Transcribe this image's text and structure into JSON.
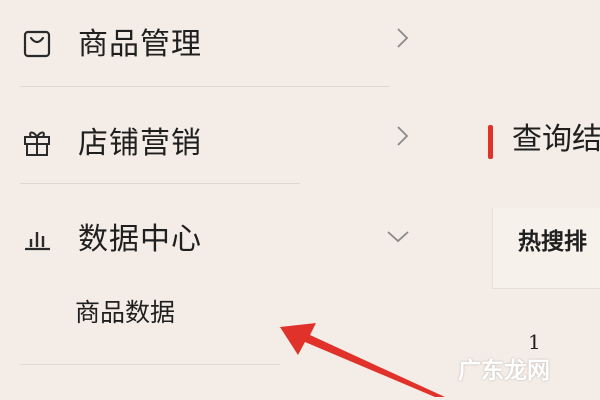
{
  "sidebar": {
    "items": [
      {
        "label": "商品管理",
        "icon": "shopping-bag-icon",
        "state": "collapsed"
      },
      {
        "label": "店铺营销",
        "icon": "gift-icon",
        "state": "collapsed"
      },
      {
        "label": "数据中心",
        "icon": "bar-chart-icon",
        "state": "expanded"
      }
    ],
    "subitems": [
      {
        "label": "商品数据"
      }
    ]
  },
  "content": {
    "section_title": "查询结",
    "tab_label": "热搜排",
    "rank_number": "1"
  },
  "watermark": "广东龙网",
  "colors": {
    "background": "#f4ece6",
    "accent": "#e0322b",
    "arrow": "#e0322b",
    "text": "#1f1f1f"
  }
}
